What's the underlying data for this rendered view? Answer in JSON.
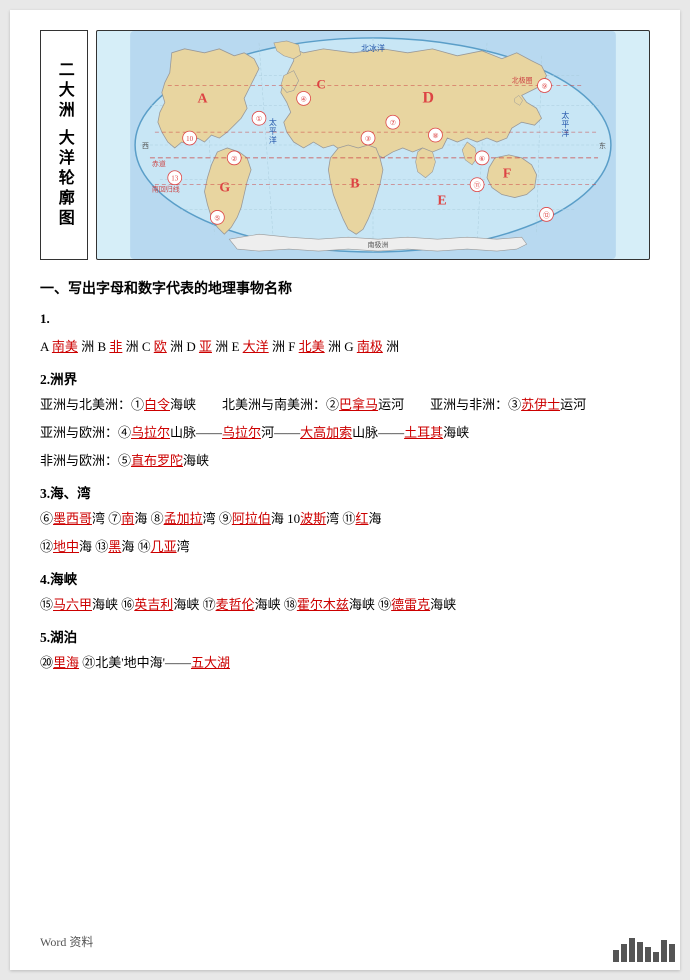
{
  "title": {
    "vertical_text": "二大洲 大洋轮廓图",
    "line1": "二大洲",
    "line2": "大洋轮廓图"
  },
  "section1": {
    "heading": "一、写出字母和数字代表的地理事物名称",
    "q1_label": "1.",
    "q1_text": "A",
    "q1_content": [
      {
        "prefix": "A",
        "underline": "南美",
        "suffix": "洲 B"
      },
      {
        "prefix": "B",
        "underline": "非",
        "suffix": "洲 C"
      },
      {
        "prefix": "C",
        "underline": "欧",
        "suffix": "洲 D"
      },
      {
        "prefix": "D",
        "underline": "亚",
        "suffix": "洲 E"
      },
      {
        "prefix": "E",
        "underline": "大洋",
        "suffix": "洲 F"
      },
      {
        "prefix": "F",
        "underline": "北美",
        "suffix": "洲 G"
      },
      {
        "prefix": "G",
        "underline": "南极",
        "suffix": "洲"
      }
    ],
    "q2_label": "2.洲界",
    "q2_lines": [
      "亚洲与北美洲：①_白令_海峡       北美洲与南美洲：②_巴拿马_运河       亚洲与非洲：③_苏伊士_运河",
      "亚洲与欧洲：④_乌拉尔_山脉——_乌拉尔_河——_大高加索_山脉——_土耳其_海峡",
      "非洲与欧洲：⑤_直布罗陀_海峡"
    ],
    "q3_label": "3.海、湾",
    "q3_lines": [
      "⑥_墨西哥_湾 ⑦_南_海 ⑧_孟加拉_湾 ⑨_阿拉伯_海 10_波斯_湾 ⑪_红_海",
      "⑫_地中_海 ⑬_黑_海 ⑭_几亚_湾"
    ],
    "q4_label": "4.海峡",
    "q4_lines": [
      "⑮_马六甲_海峡 ⑯_英吉利_海峡 ⑰_麦哲伦_海峡 ⑱_霍尔木兹_海峡 ⑲_德雷克_海峡"
    ],
    "q5_label": "5.湖泊",
    "q5_lines": [
      "⑳_里海_ ㉑北美'地中海'——_五大湖_"
    ]
  },
  "footer": {
    "text": "Word 资料"
  }
}
